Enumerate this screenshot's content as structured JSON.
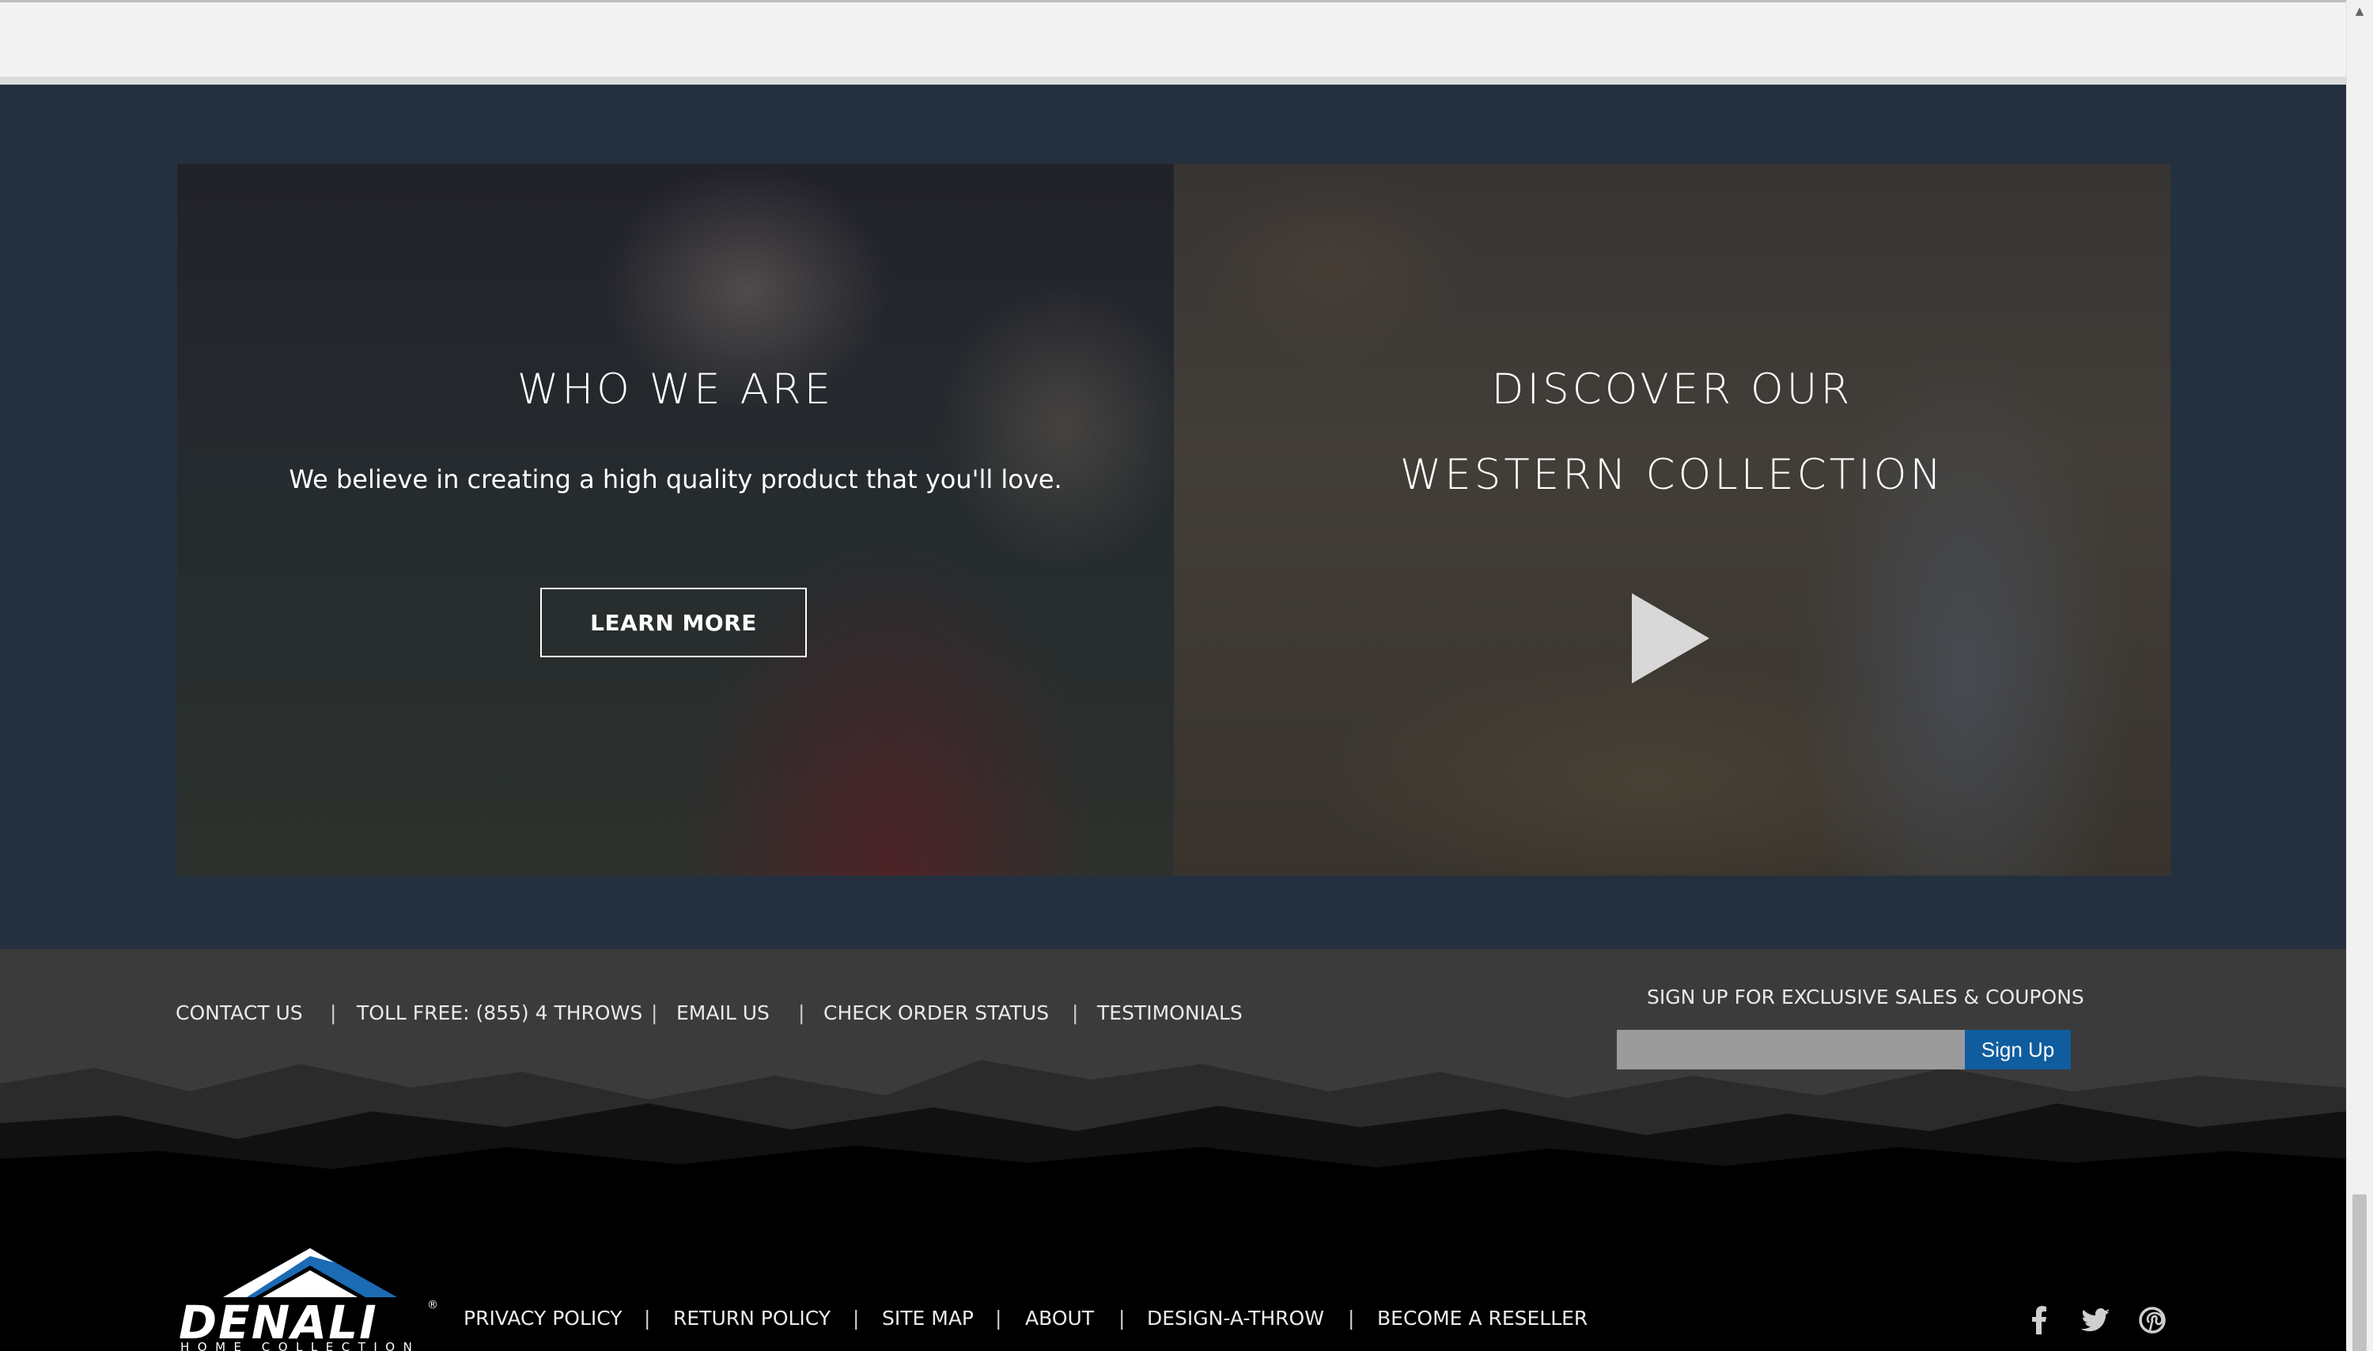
{
  "browser": {
    "scroll_up_glyph": "▲"
  },
  "hero": {
    "left_panel": {
      "title": "WHO WE ARE",
      "text": "We believe in creating a high quality product that you'll love.",
      "button_label": "LEARN MORE"
    },
    "right_panel": {
      "title_line1": "DISCOVER OUR",
      "title_line2": "WESTERN COLLECTION",
      "play_icon": "play-icon"
    }
  },
  "footer": {
    "nav_links": [
      "CONTACT US",
      "TOLL FREE: (855) 4 THROWS",
      "EMAIL US",
      "CHECK ORDER STATUS",
      "TESTIMONIALS"
    ],
    "separator": "|",
    "signup": {
      "title": "SIGN UP FOR EXCLUSIVE SALES & COUPONS",
      "input_placeholder": "",
      "button_label": "Sign Up"
    },
    "logo": {
      "brand": "DENALI",
      "tagline": "HOME COLLECTION",
      "registered_mark": "®"
    },
    "bottom_links": [
      "PRIVACY POLICY",
      "RETURN POLICY",
      "SITE MAP",
      "ABOUT",
      "DESIGN-A-THROW",
      "BECOME A RESELLER"
    ],
    "social_icons": [
      "facebook-icon",
      "twitter-icon",
      "pinterest-icon"
    ],
    "social_glyphs": [
      "f",
      "🐦",
      "℗"
    ]
  },
  "colors": {
    "hero_bg": "#24303e",
    "footer_top": "#3b3b3b",
    "footer_bottom": "#000000",
    "signup_button": "#0f5d9f",
    "logo_blue": "#1b6bb5"
  }
}
